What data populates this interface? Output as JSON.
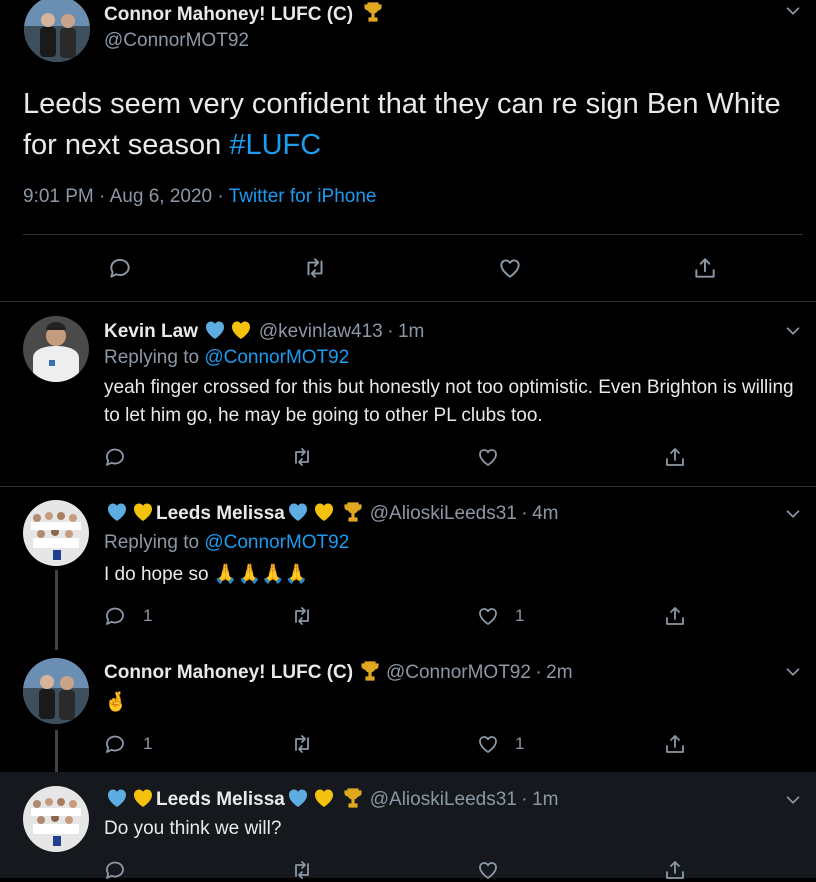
{
  "main_tweet": {
    "author_name": "Connor Mahoney! LUFC (C)",
    "author_handle": "@ConnorMOT92",
    "text": "Leeds seem very confident that they can re sign Ben White for next season ",
    "hashtag": "#LUFC",
    "time": "9:01 PM",
    "date": "Aug 6, 2020",
    "source": "Twitter for iPhone"
  },
  "replies": [
    {
      "author_name": "Kevin Law",
      "author_handle": "@kevinlaw413",
      "age": "1m",
      "replying_prefix": "Replying to ",
      "replying_to": "@ConnorMOT92",
      "text": "yeah finger crossed for this but honestly not too optimistic. Even Brighton is willing to let him go,  he may be going to other PL clubs too.",
      "reply_count": "",
      "like_count": ""
    },
    {
      "author_name": "Leeds Melissa",
      "author_handle": "@AlioskiLeeds31",
      "age": "4m",
      "replying_prefix": "Replying to ",
      "replying_to": "@ConnorMOT92",
      "text": "I do hope so ",
      "emoji": "🙏🙏🙏🙏",
      "reply_count": "1",
      "like_count": "1"
    },
    {
      "author_name": "Connor Mahoney! LUFC (C)",
      "author_handle": "@ConnorMOT92",
      "age": "2m",
      "text": "🤞",
      "reply_count": "1",
      "like_count": "1"
    },
    {
      "author_name": "Leeds Melissa",
      "author_handle": "@AlioskiLeeds31",
      "age": "1m",
      "text": "Do you think we will?"
    }
  ],
  "separator": "·",
  "icons": {
    "reply": "reply-icon",
    "retweet": "retweet-icon",
    "like": "like-icon",
    "share": "share-icon",
    "more": "chevron-down-icon",
    "trophy": "trophy-icon",
    "heart": "heart-emoji-icon"
  },
  "colors": {
    "background": "#000000",
    "link": "#1d9bf0",
    "muted": "#8b98a5",
    "text": "#e7e9ea",
    "blue_heart": "#5dade2",
    "yellow_heart": "#f4c20d",
    "trophy": "#e0a820"
  }
}
